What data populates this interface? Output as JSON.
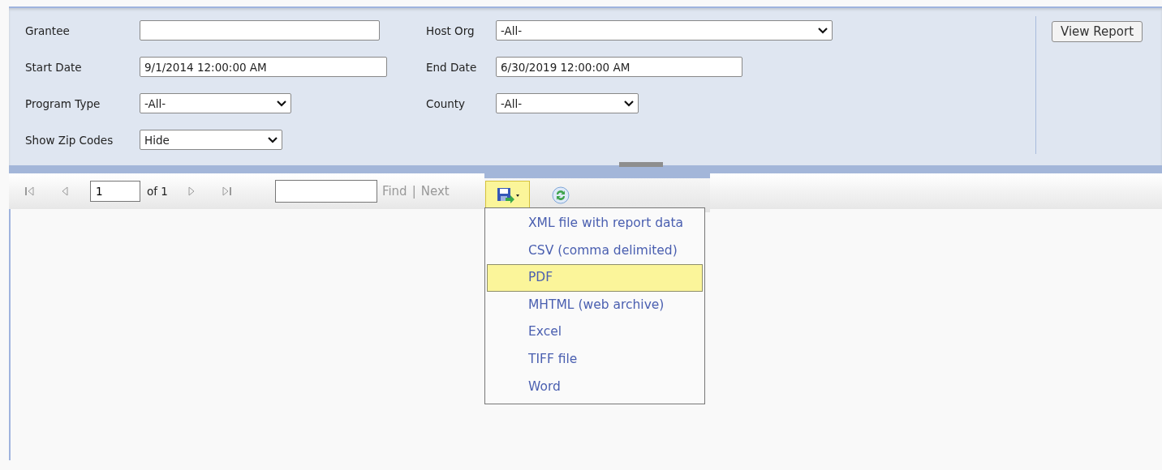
{
  "parameters": {
    "rows": [
      [
        {
          "label": "Grantee",
          "kind": "text"
        },
        {
          "label": "Host Org",
          "kind": "select",
          "value": "-All-"
        }
      ],
      [
        {
          "label": "Start Date",
          "kind": "text",
          "value": "9/1/2014 12:00:00 AM"
        },
        {
          "label": "End Date",
          "kind": "text",
          "value": "6/30/2019 12:00:00 AM"
        }
      ],
      [
        {
          "label": "Program Type",
          "kind": "select",
          "value": "-All-"
        },
        {
          "label": "County",
          "kind": "select",
          "value": "-All-"
        }
      ],
      [
        {
          "label": "Show Zip Codes",
          "kind": "select",
          "value": "Hide"
        }
      ]
    ],
    "view_button": "View Report"
  },
  "toolbar": {
    "page": "1",
    "of_label": "of 1",
    "find_label": "Find",
    "separator": "|",
    "next_label": "Next"
  },
  "export_menu": {
    "items": [
      {
        "label": "XML file with report data",
        "selected": false
      },
      {
        "label": "CSV (comma delimited)",
        "selected": false
      },
      {
        "label": "PDF",
        "selected": true
      },
      {
        "label": "MHTML (web archive)",
        "selected": false
      },
      {
        "label": "Excel",
        "selected": false
      },
      {
        "label": "TIFF file",
        "selected": false
      },
      {
        "label": "Word",
        "selected": false
      }
    ]
  }
}
